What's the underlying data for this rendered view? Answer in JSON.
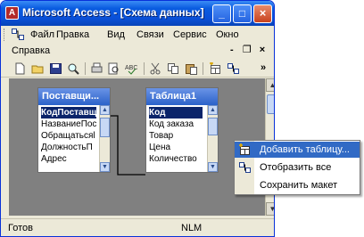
{
  "window": {
    "title": "Microsoft Access - [Схема данных]",
    "app_icon_glyph": "A",
    "buttons": {
      "minimize": "_",
      "maximize": "□",
      "close": "×"
    }
  },
  "menubar": {
    "items": [
      "Файл",
      "Правка",
      "Вид",
      "Связи",
      "Сервис",
      "Окно"
    ],
    "help": "Справка",
    "mdi_buttons": {
      "minimize": "-",
      "restore": "❐",
      "close": "×"
    }
  },
  "toolbar": {
    "icons": [
      "new-icon",
      "open-icon",
      "save-icon",
      "search-icon",
      "print-icon",
      "print-preview-icon",
      "spellcheck-icon",
      "cut-icon",
      "copy-icon",
      "paste-icon",
      "show-table-icon",
      "show-all-icon",
      "toolbar-options-icon"
    ],
    "overflow": "»"
  },
  "tables": [
    {
      "title": "Поставщи...",
      "fields": [
        "КодПоставщ",
        "НазваниеПос",
        "Обращатьсяl",
        "ДолжностьП",
        "Адрес"
      ],
      "selected_index": 0
    },
    {
      "title": "Таблица1",
      "fields": [
        "Код",
        "Код заказа",
        "Товар",
        "Цена",
        "Количество"
      ],
      "selected_index": 0
    }
  ],
  "context_menu": {
    "items": [
      "Добавить таблицу...",
      "Отобразить все",
      "Сохранить макет"
    ],
    "highlighted_index": 0
  },
  "statusbar": {
    "status": "Готов",
    "nlm": "NLM"
  },
  "colors": {
    "title_bar": "#0a50d8",
    "workspace": "#808080",
    "selection": "#0a246a",
    "menu_highlight": "#316ac5"
  }
}
